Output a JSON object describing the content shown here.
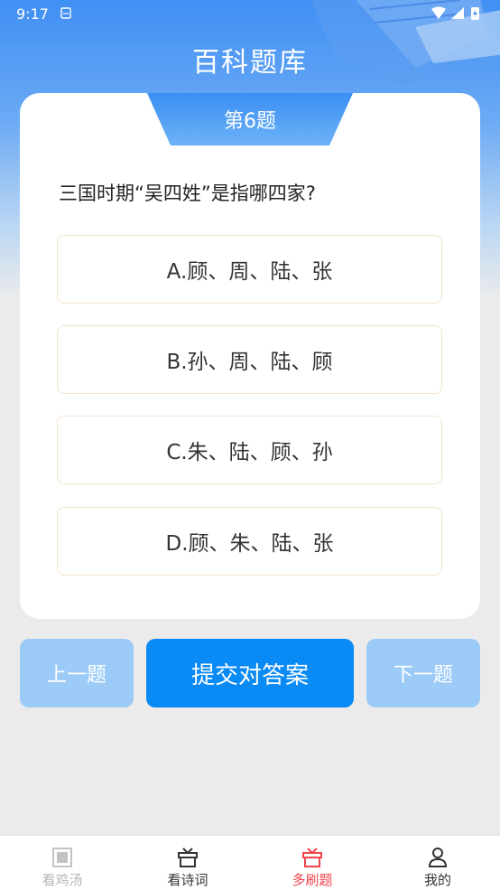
{
  "status": {
    "time": "9:17"
  },
  "header": {
    "title": "百科题库"
  },
  "quiz": {
    "number_label": "第6题",
    "question": "三国时期“吴四姓”是指哪四家?",
    "options": [
      {
        "label": "A.顾、周、陆、张"
      },
      {
        "label": "B.孙、周、陆、顾"
      },
      {
        "label": "C.朱、陆、顾、孙"
      },
      {
        "label": "D.顾、朱、陆、张"
      }
    ]
  },
  "buttons": {
    "prev": "上一题",
    "submit": "提交对答案",
    "next": "下一题"
  },
  "tabbar": {
    "items": [
      {
        "label": "看鸡汤",
        "icon": "frame-icon",
        "state": "disabled"
      },
      {
        "label": "看诗词",
        "icon": "gift-icon",
        "state": "normal"
      },
      {
        "label": "多刷题",
        "icon": "gift-icon",
        "state": "active"
      },
      {
        "label": "我的",
        "icon": "user-icon",
        "state": "normal"
      }
    ],
    "colors": {
      "active": "#f0464d",
      "normal": "#333333",
      "disabled": "#b5b5b5"
    }
  },
  "colors": {
    "primary": "#0a8af5",
    "secondary_button": "#9ccbf7",
    "header": "#3f8ff4"
  }
}
